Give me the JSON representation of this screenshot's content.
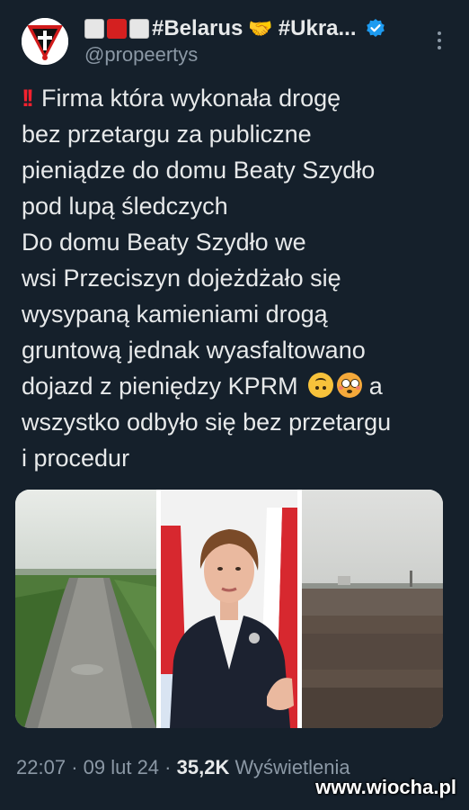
{
  "author": {
    "display_name": "#Belarus",
    "display_name_suffix": "#Ukra...",
    "flag_colors": [
      "#e6e6e6",
      "#d42020",
      "#e6e6e6"
    ],
    "handle": "@propeertys",
    "verified": true,
    "handshake_icon": "🤝"
  },
  "tweet": {
    "alert_icon": "‼️",
    "lines": [
      "Firma która wykonała drogę",
      "bez przetargu za publiczne",
      "pieniądze do domu Beaty Szydło",
      "pod lupą śledczych",
      "Do domu Beaty Szydło we",
      "wsi Przeciszyn dojeżdżało się",
      "wysypaną kamieniami drogą",
      "gruntową jednak wyasfaltowano",
      "dojazd z pieniędzy KPRM",
      "wszystko odbyło się bez przetargu",
      "i procedur"
    ],
    "line_9_tail": "a"
  },
  "media": {
    "panels": [
      "country-road-photo",
      "politician-portrait-photo",
      "gravel-field-photo"
    ]
  },
  "meta": {
    "time": "22:07",
    "separator": "·",
    "date": "09 lut 24",
    "views_count": "35,2K",
    "views_label": "Wyświetlenia"
  },
  "watermark": "www.wiocha.pl",
  "colors": {
    "background": "#15202b",
    "text": "#e7e9ea",
    "secondary": "#8b98a5",
    "verified": "#1d9bf0",
    "alert": "#f4212e"
  }
}
